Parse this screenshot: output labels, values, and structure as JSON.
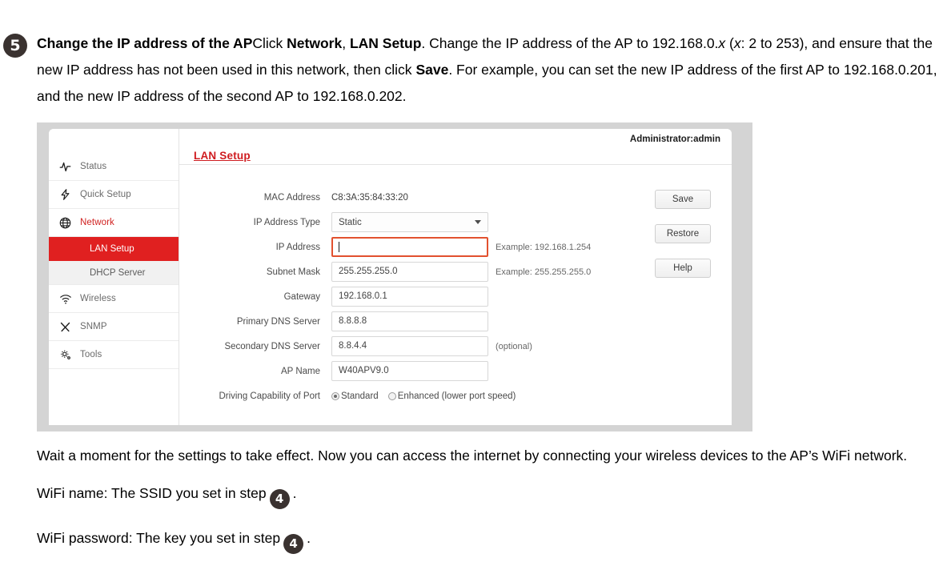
{
  "step": {
    "number": "5",
    "title": "Change the IP address of the AP",
    "body_1": "Click ",
    "bold_network": "Network",
    "comma_1": ", ",
    "bold_lansetup": "LAN Setup",
    "body_2": ". Change the IP address of the AP to 192.168.0.",
    "italic_x1": "x",
    "body_3": " (",
    "italic_x2": "x",
    "body_4": ": 2 to 253), and ensure that the new IP address has not been used in this network, then click ",
    "bold_save": "Save",
    "body_5": ". For example, you can set the new IP address of the first AP to 192.168.0.201, and the new IP address of the second AP to 192.168.0.202."
  },
  "router_ui": {
    "admin_label": "Administrator:admin",
    "page_title": "LAN Setup",
    "sidebar": [
      {
        "label": "Status",
        "icon": "pulse-icon",
        "type": "nav",
        "active": false
      },
      {
        "label": "Quick Setup",
        "icon": "lightning-icon",
        "type": "nav",
        "active": false
      },
      {
        "label": "Network",
        "icon": "globe-icon",
        "type": "nav",
        "active": true
      },
      {
        "label": "LAN Setup",
        "icon": "",
        "type": "sub-selected",
        "active": true
      },
      {
        "label": "DHCP Server",
        "icon": "",
        "type": "sub",
        "active": false
      },
      {
        "label": "Wireless",
        "icon": "wifi-icon",
        "type": "nav",
        "active": false
      },
      {
        "label": "SNMP",
        "icon": "tools-icon",
        "type": "nav",
        "active": false
      },
      {
        "label": "Tools",
        "icon": "gears-icon",
        "type": "nav",
        "active": false
      }
    ],
    "form": {
      "mac_label": "MAC Address",
      "mac_value": "C8:3A:35:84:33:20",
      "ip_type_label": "IP Address Type",
      "ip_type_value": "Static",
      "ip_label": "IP Address",
      "ip_value": "",
      "ip_hint": "Example: 192.168.1.254",
      "subnet_label": "Subnet Mask",
      "subnet_value": "255.255.255.0",
      "subnet_hint": "Example: 255.255.255.0",
      "gateway_label": "Gateway",
      "gateway_value": "192.168.0.1",
      "dns1_label": "Primary DNS Server",
      "dns1_value": "8.8.8.8",
      "dns2_label": "Secondary DNS Server",
      "dns2_value": "8.8.4.4",
      "dns2_hint": "(optional)",
      "apname_label": "AP Name",
      "apname_value": "W40APV9.0",
      "driving_label": "Driving Capability of Port",
      "driving_opt1": "Standard",
      "driving_opt2": "Enhanced (lower port speed)"
    },
    "buttons": {
      "save": "Save",
      "restore": "Restore",
      "help": "Help"
    },
    "colors": {
      "accent_red": "#e02020",
      "title_red": "#cf1c20",
      "focus_border": "#e2512f",
      "window_gray": "#d4d4d4"
    }
  },
  "tail": {
    "p1": "Wait a moment for the settings to take effect. Now you can access the internet by connecting your wireless devices to the AP’s WiFi network.",
    "p2_pre": "WiFi name: The SSID you set in step",
    "p2_badge": "4",
    "p2_post": ".",
    "p3_pre": "WiFi password: The key you set in step",
    "p3_badge": "4",
    "p3_post": "."
  }
}
